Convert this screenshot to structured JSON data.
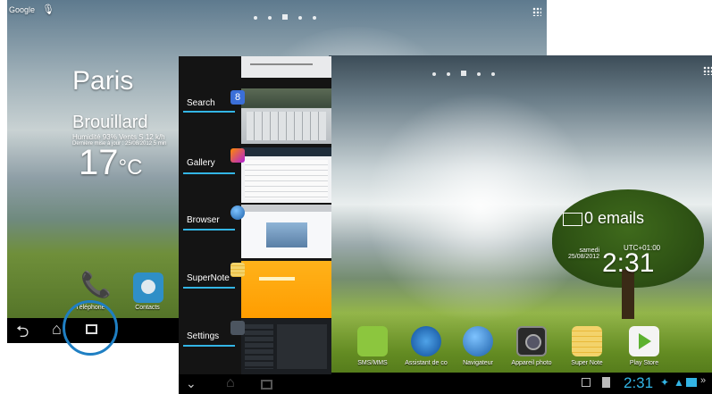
{
  "tablet_left": {
    "search_label": "Google",
    "city": "Paris",
    "weather": "Brouillard",
    "weather_details": "Humidité 93% Vents S 12 k/h",
    "weather_updated": "Dernière mise à jour : 25/08/2012 5 min",
    "temperature": "17",
    "unit": "°C",
    "apps": [
      {
        "label": "Téléphone",
        "icon": "phone-icon"
      },
      {
        "label": "Contacts",
        "icon": "contacts-icon"
      }
    ]
  },
  "recents_panel": {
    "items": [
      {
        "label": "Search"
      },
      {
        "label": "Gallery"
      },
      {
        "label": "Browser"
      },
      {
        "label": "SuperNote"
      },
      {
        "label": "Settings"
      }
    ]
  },
  "tablet_right": {
    "email_widget": "0 emails",
    "clock": {
      "day": "samedi",
      "date": "25/08/2012",
      "zone": "UTC+01:00",
      "time": "2:31"
    },
    "dock_apps": [
      {
        "label": "SMS/MMS",
        "icon": "sms-icon"
      },
      {
        "label": "Assistant de co",
        "icon": "bluetooth-icon"
      },
      {
        "label": "Navigateur",
        "icon": "browser-globe-icon"
      },
      {
        "label": "Appareil photo",
        "icon": "camera-icon"
      },
      {
        "label": "Super Note",
        "icon": "supernote-icon"
      },
      {
        "label": "Play Store",
        "icon": "play-store-icon"
      }
    ],
    "status_time": "2:31"
  },
  "colors": {
    "highlight_circle": "#1f7fc3",
    "accent": "#33b5e5"
  }
}
